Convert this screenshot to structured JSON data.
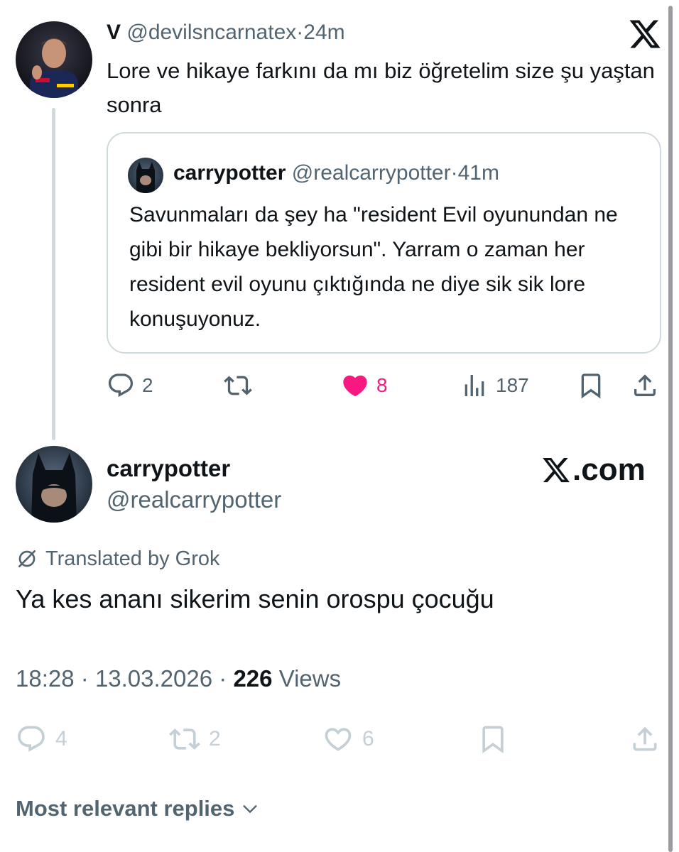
{
  "quoting_tweet": {
    "display_name": "V",
    "handle": "@devilsncarnatex",
    "time": "24m",
    "text": "Lore ve hikaye farkını da mı biz öğretelim size şu yaştan sonra",
    "actions": {
      "replies": "2",
      "reposts": "",
      "likes": "8",
      "views": "187"
    }
  },
  "quoted_tweet": {
    "display_name": "carrypotter",
    "handle": "@realcarrypotter",
    "time": "41m",
    "text": "Savunmaları da şey ha \"resident Evil oyunundan ne gibi bir hikaye bekliyorsun\". Yarram o zaman her resident evil oyunu çıktığında ne diye sik sik lore konuşuyonuz."
  },
  "main_tweet": {
    "display_name": "carrypotter",
    "handle": "@realcarrypotter",
    "translated_label": "Translated by Grok",
    "text": "Ya kes ananı sikerim senin orospu çocuğu",
    "time": "18:28",
    "date": "13.03.2026",
    "views_count": "226",
    "views_label": "Views",
    "actions": {
      "replies": "4",
      "reposts": "2",
      "likes": "6"
    }
  },
  "watermark": ".com",
  "replies_sort_label": "Most relevant replies",
  "colors": {
    "text_primary": "#0f1419",
    "text_secondary": "#536471",
    "like_active": "#f91880",
    "border": "#cfd9de",
    "icon_faded": "#c4cfd6"
  },
  "icons": [
    "x-logo-icon",
    "reply-icon",
    "repost-icon",
    "heart-icon",
    "views-icon",
    "bookmark-icon",
    "share-icon",
    "grok-translate-icon",
    "chevron-down-icon"
  ]
}
